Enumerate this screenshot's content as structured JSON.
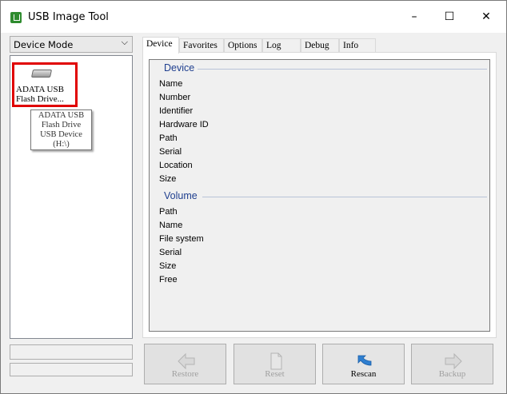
{
  "window": {
    "title": "USB Image Tool"
  },
  "controls": {
    "minimize": "–",
    "maximize": "☐",
    "close": "✕"
  },
  "left": {
    "mode": "Device Mode",
    "device_label_line1": "ADATA USB",
    "device_label_line2": "Flash Drive...",
    "tooltip": [
      "ADATA USB",
      "Flash Drive",
      "USB Device",
      "(H:\\)"
    ]
  },
  "tabs": [
    "Device",
    "Favorites",
    "Options",
    "Log",
    "Debug",
    "Info"
  ],
  "device_group": {
    "title": "Device",
    "fields": [
      "Name",
      "Number",
      "Identifier",
      "Hardware ID",
      "Path",
      "Serial",
      "Location",
      "Size"
    ]
  },
  "volume_group": {
    "title": "Volume",
    "fields": [
      "Path",
      "Name",
      "File system",
      "Serial",
      "Size",
      "Free"
    ]
  },
  "buttons": {
    "restore": "Restore",
    "reset": "Reset",
    "rescan": "Rescan",
    "backup": "Backup"
  }
}
